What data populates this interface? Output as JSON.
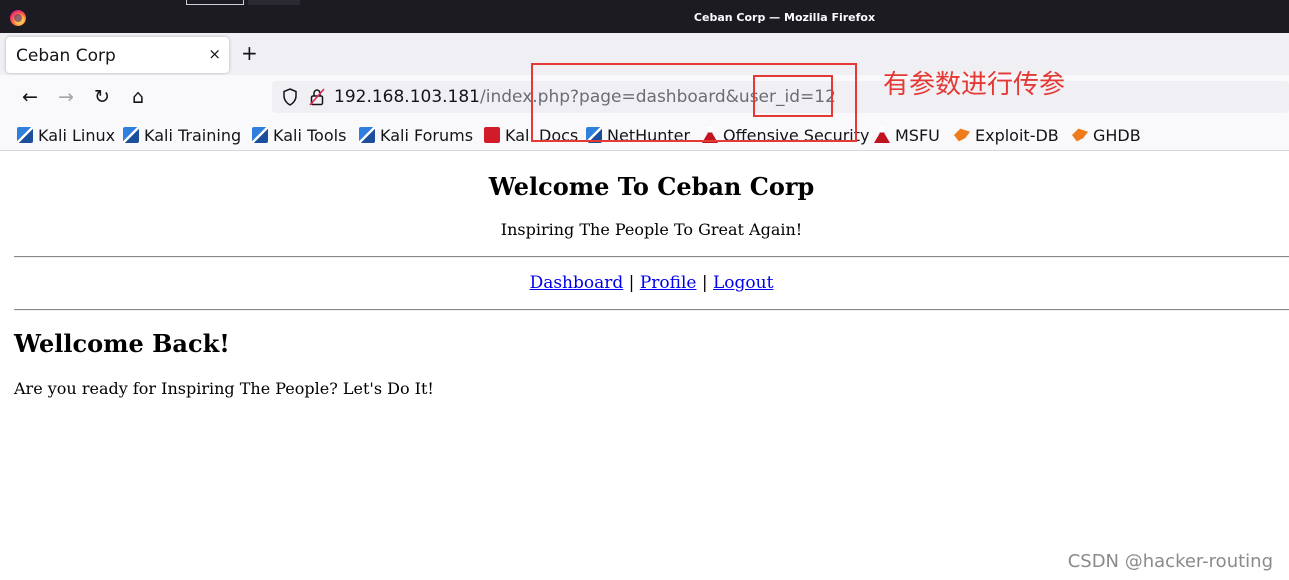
{
  "window": {
    "title": "Ceban Corp — Mozilla Firefox"
  },
  "tab": {
    "title": "Ceban Corp",
    "close_glyph": "×",
    "new_tab_glyph": "+"
  },
  "nav": {
    "back_glyph": "←",
    "forward_glyph": "→",
    "reload_glyph": "↻",
    "home_glyph": "⌂",
    "url_host": "192.168.103.181",
    "url_path": "/index.php?page=dashboard&user_id=12"
  },
  "bookmarks": [
    {
      "label": "Kali Linux",
      "icon": "kali-dragon-icon"
    },
    {
      "label": "Kali Training",
      "icon": "kali-dragon-icon"
    },
    {
      "label": "Kali Tools",
      "icon": "kali-dragon-icon"
    },
    {
      "label": "Kali Forums",
      "icon": "kali-dragon-icon"
    },
    {
      "label": "Kali Docs",
      "icon": "kali-docs-icon"
    },
    {
      "label": "NetHunter",
      "icon": "nethunter-icon"
    },
    {
      "label": "Offensive Security",
      "icon": "flask-icon"
    },
    {
      "label": "MSFU",
      "icon": "flask-icon"
    },
    {
      "label": "Exploit-DB",
      "icon": "exploit-db-icon"
    },
    {
      "label": "GHDB",
      "icon": "exploit-db-icon"
    }
  ],
  "page": {
    "title": "Welcome To Ceban Corp",
    "tagline": "Inspiring The People To Great Again!",
    "menu": {
      "dashboard": "Dashboard",
      "profile": "Profile",
      "logout": "Logout",
      "separator": "|"
    },
    "heading": "Wellcome Back!",
    "body": "Are you ready for Inspiring The People? Let's Do It!"
  },
  "annotation": {
    "note": "有参数进行传参",
    "color": "#e53935"
  },
  "watermark": "CSDN @hacker-routing"
}
